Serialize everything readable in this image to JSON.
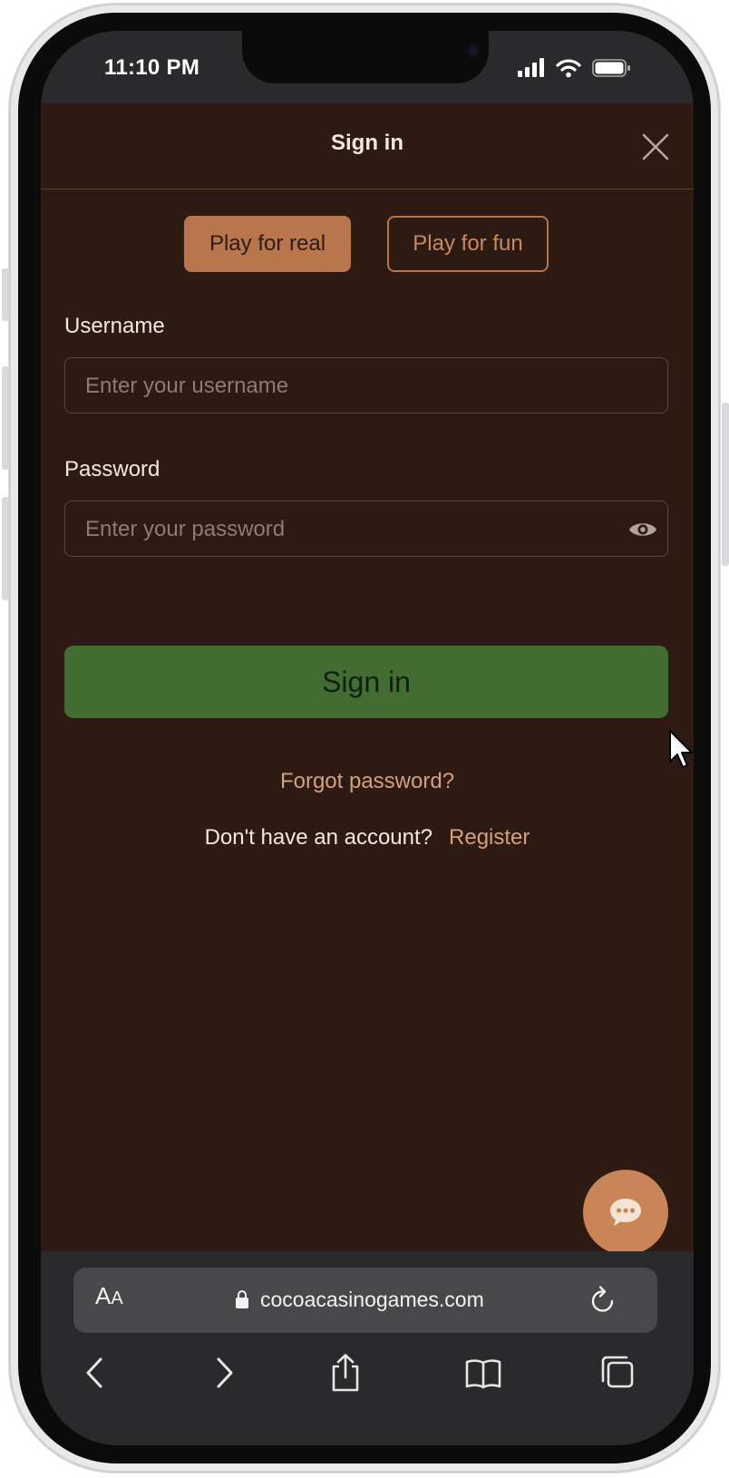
{
  "status_bar": {
    "time": "11:10 PM",
    "icons": [
      "cellular-signal-icon",
      "wifi-icon",
      "battery-icon"
    ]
  },
  "modal": {
    "title": "Sign in",
    "close_icon": "close-icon",
    "modes": {
      "real_label": "Play for real",
      "fun_label": "Play for fun",
      "selected": "real"
    },
    "username": {
      "label": "Username",
      "placeholder": "Enter your username",
      "value": ""
    },
    "password": {
      "label": "Password",
      "placeholder": "Enter your password",
      "value": "",
      "toggle_icon": "eye-icon"
    },
    "submit_label": "Sign in",
    "forgot_label": "Forgot password?",
    "no_account_text": "Don't have an account?",
    "register_label": "Register"
  },
  "chat_button": {
    "icon": "chat-bubble-icon"
  },
  "browser": {
    "text_size_big": "A",
    "text_size_small": "A",
    "url": "cocoacasinogames.com",
    "lock_icon": "lock-icon",
    "reload_icon": "reload-icon",
    "toolbar_icons": [
      "back-icon",
      "forward-icon",
      "share-icon",
      "bookmarks-icon",
      "tabs-icon"
    ]
  },
  "colors": {
    "background": "#2d1a12",
    "accent": "#b9754c",
    "accent_text": "#d2a17d",
    "primary_button": "#426c31",
    "text": "#f3e8dc"
  }
}
